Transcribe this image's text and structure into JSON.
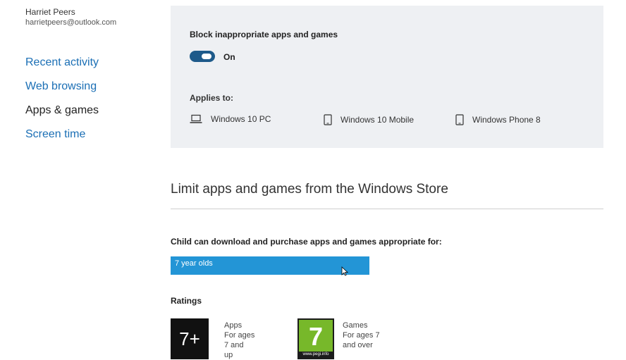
{
  "user": {
    "name": "Harriet Peers",
    "email": "harrietpeers@outlook.com"
  },
  "sidebar": {
    "items": [
      {
        "label": "Recent activity",
        "active": false
      },
      {
        "label": "Web browsing",
        "active": false
      },
      {
        "label": "Apps & games",
        "active": true
      },
      {
        "label": "Screen time",
        "active": false
      }
    ]
  },
  "block_card": {
    "title": "Block inappropriate apps and games",
    "toggle_state": "On",
    "applies_label": "Applies to:",
    "devices": [
      {
        "label": "Windows 10 PC",
        "icon": "laptop-icon"
      },
      {
        "label": "Windows 10 Mobile",
        "icon": "phone-icon"
      },
      {
        "label": "Windows Phone 8",
        "icon": "phone-icon"
      }
    ]
  },
  "limit_section": {
    "title": "Limit apps and games from the Windows Store",
    "child_label": "Child can download and purchase apps and games appropriate for:",
    "selected_age": "7 year olds",
    "ratings_label": "Ratings",
    "ratings": [
      {
        "badge": "7+",
        "lines": [
          "Apps",
          "For ages",
          "7 and",
          "up"
        ]
      },
      {
        "badge": "7",
        "badge_footer": "www.pegi.info",
        "lines": [
          "Games",
          "For ages 7",
          "and over"
        ]
      }
    ]
  },
  "colors": {
    "link": "#1b6fb5",
    "card_bg": "#eef0f3",
    "toggle_on": "#1e5a8a",
    "select_bg": "#2395d6",
    "pegi_green": "#77b82a"
  }
}
